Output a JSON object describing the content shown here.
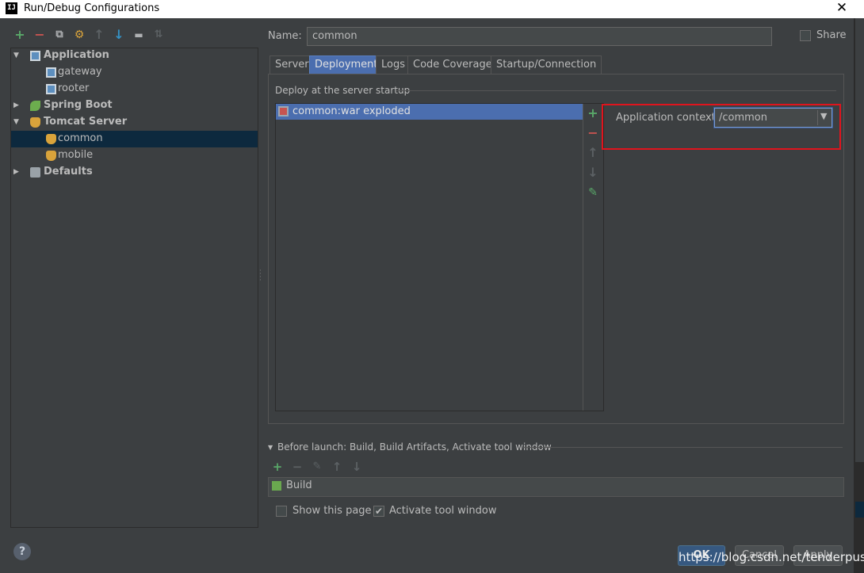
{
  "window": {
    "title": "Run/Debug Configurations",
    "app_icon": "IJ",
    "close_glyph": "✕"
  },
  "toolbar": {
    "add": "+",
    "remove": "−",
    "copy": "⧉",
    "edit_defaults": "⚙",
    "move_up": "↑",
    "move_down": "↓",
    "folder": "▬",
    "sort": "⇅"
  },
  "tree": {
    "items": [
      {
        "label": "Application",
        "bold": true,
        "expanded": true,
        "icon": "application-icon"
      },
      {
        "label": "gateway",
        "bold": false,
        "icon": "application-icon"
      },
      {
        "label": "rooter",
        "bold": false,
        "icon": "application-icon"
      },
      {
        "label": "Spring Boot",
        "bold": true,
        "expanded": false,
        "icon": "spring-boot-icon"
      },
      {
        "label": "Tomcat Server",
        "bold": true,
        "expanded": true,
        "icon": "tomcat-icon"
      },
      {
        "label": "common",
        "bold": false,
        "selected": true,
        "icon": "tomcat-icon"
      },
      {
        "label": "mobile",
        "bold": false,
        "icon": "tomcat-icon"
      },
      {
        "label": "Defaults",
        "bold": true,
        "expanded": false,
        "icon": "defaults-icon"
      }
    ],
    "arrow_expanded": "▼",
    "arrow_collapsed": "▶"
  },
  "name_field": {
    "label": "Name:",
    "value": "common"
  },
  "share": {
    "label": "Share",
    "checked": false
  },
  "tabs": [
    {
      "label": "Server",
      "active": false
    },
    {
      "label": "Deployment",
      "active": true
    },
    {
      "label": "Logs",
      "active": false
    },
    {
      "label": "Code Coverage",
      "active": false
    },
    {
      "label": "Startup/Connection",
      "active": false
    }
  ],
  "deployment": {
    "heading": "Deploy at the server startup",
    "artifacts": [
      "common:war exploded"
    ],
    "side_buttons": {
      "add": "+",
      "remove": "−",
      "up": "↑",
      "down": "↓",
      "edit": "✎"
    },
    "app_context_label": "Application context:",
    "app_context_value": "/common",
    "dropdown_arrow": "▼"
  },
  "before_launch": {
    "arrow": "▼",
    "label": "Before launch: Build, Build Artifacts, Activate tool window",
    "buttons": {
      "add": "+",
      "remove": "−",
      "edit": "✎",
      "up": "↑",
      "down": "↓"
    },
    "items": [
      "Build"
    ]
  },
  "options": {
    "show_page": {
      "label": "Show this page",
      "checked": false
    },
    "activate_tool_window": {
      "label": "Activate tool window",
      "checked": true,
      "check_glyph": "✔"
    }
  },
  "help": "?",
  "buttons": {
    "ok": "OK",
    "cancel": "Cancel",
    "apply": "Apply"
  },
  "watermark": "https://blog.csdn.net/tenderpuss",
  "colors": {
    "background": "#3c3f41",
    "selection": "#0d293e",
    "accent": "#4b6eaf",
    "highlight_box": "#e0141d",
    "green": "#59a869",
    "red": "#c75450",
    "blue": "#3592c4"
  }
}
